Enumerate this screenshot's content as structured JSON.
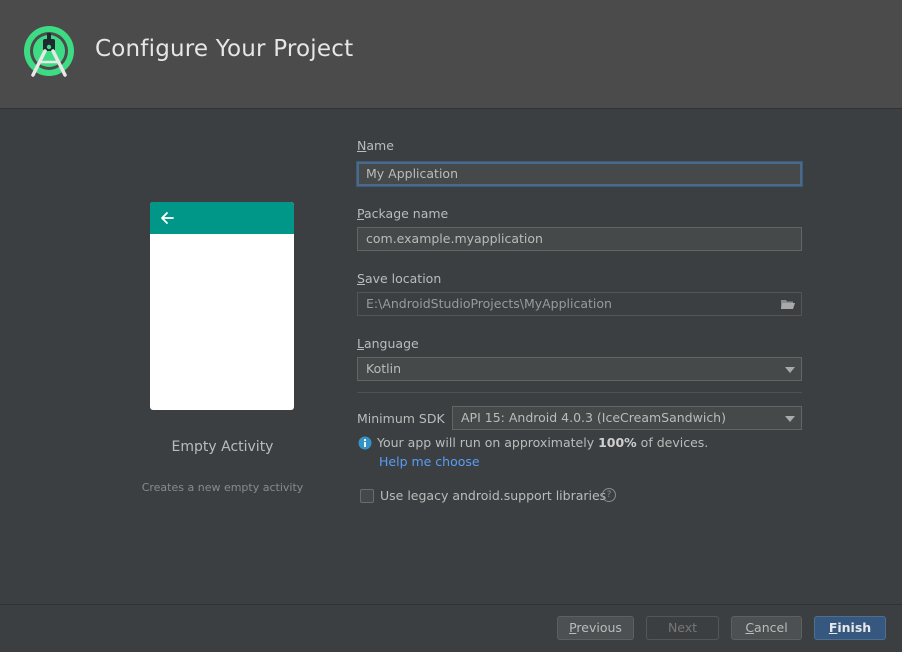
{
  "window": {
    "title": "Configure Your Project",
    "logo_icon": "android-studio-icon"
  },
  "template": {
    "name": "Empty Activity",
    "description": "Creates a new empty activity",
    "preview_color": "#009688",
    "preview_back_icon": "arrow-left-icon"
  },
  "form": {
    "name": {
      "label_mnemonic": "N",
      "label_rest": "ame",
      "value": "My Application"
    },
    "package": {
      "label_mnemonic": "P",
      "label_rest": "ackage name",
      "value": "com.example.myapplication"
    },
    "save_location": {
      "label_mnemonic": "S",
      "label_rest": "ave location",
      "value": "E:\\AndroidStudioProjects\\MyApplication",
      "browse_icon": "folder-icon"
    },
    "language": {
      "label_mnemonic": "L",
      "label_rest": "anguage",
      "value": "Kotlin"
    },
    "min_sdk": {
      "label": "Minimum SDK",
      "value": "API 15: Android 4.0.3 (IceCreamSandwich)"
    },
    "info": {
      "prefix": "Your app will run on approximately ",
      "percent": "100%",
      "suffix": " of devices.",
      "icon": "info-icon"
    },
    "help_link": "Help me choose",
    "legacy": {
      "label": "Use legacy android.support libraries",
      "checked": false,
      "help_icon": "question-icon"
    }
  },
  "buttons": {
    "previous": {
      "mnemonic": "P",
      "rest": "revious",
      "enabled": true
    },
    "next": {
      "label": "Next",
      "enabled": false
    },
    "cancel": {
      "mnemonic": "C",
      "rest": "ancel",
      "enabled": true
    },
    "finish": {
      "mnemonic": "F",
      "rest": "inish",
      "enabled": true
    }
  },
  "colors": {
    "background": "#3c3f41",
    "header": "#4b4b4b",
    "accent_link": "#589df6",
    "primary_button": "#365880",
    "logo_green": "#3ddc84"
  }
}
